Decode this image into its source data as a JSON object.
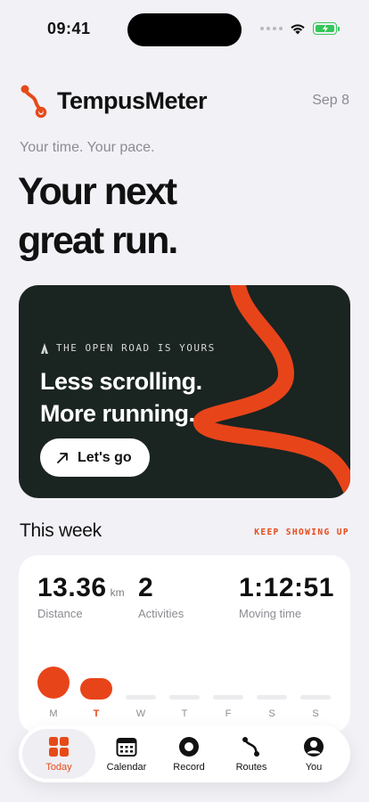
{
  "status_bar": {
    "time": "09:41"
  },
  "header": {
    "app_name": "TempusMeter",
    "date": "Sep 8"
  },
  "tagline": "Your time. Your pace.",
  "headline": {
    "line1": "Your next",
    "line2": "great run."
  },
  "hero": {
    "eyebrow": "THE OPEN ROAD IS YOURS",
    "title_line1": "Less scrolling.",
    "title_line2": "More running.",
    "button_label": "Let's go"
  },
  "week": {
    "title": "This week",
    "link": "KEEP SHOWING UP",
    "stats": [
      {
        "value": "13.36",
        "unit": "km",
        "label": "Distance"
      },
      {
        "value": "2",
        "unit": "",
        "label": "Activities"
      },
      {
        "value": "1:12:51",
        "unit": "",
        "label": "Moving time"
      }
    ],
    "days": [
      {
        "label": "M",
        "today": false
      },
      {
        "label": "T",
        "today": true
      },
      {
        "label": "W",
        "today": false
      },
      {
        "label": "T",
        "today": false
      },
      {
        "label": "F",
        "today": false
      },
      {
        "label": "S",
        "today": false
      },
      {
        "label": "S",
        "today": false
      }
    ]
  },
  "tabs": [
    {
      "label": "Today",
      "icon": "grid-icon",
      "active": true
    },
    {
      "label": "Calendar",
      "icon": "calendar-icon",
      "active": false
    },
    {
      "label": "Record",
      "icon": "record-icon",
      "active": false
    },
    {
      "label": "Routes",
      "icon": "route-icon",
      "active": false
    },
    {
      "label": "You",
      "icon": "person-icon",
      "active": false
    }
  ],
  "colors": {
    "accent": "#e64a19",
    "hero_bg": "#1a2421",
    "background": "#f2f1f6"
  }
}
